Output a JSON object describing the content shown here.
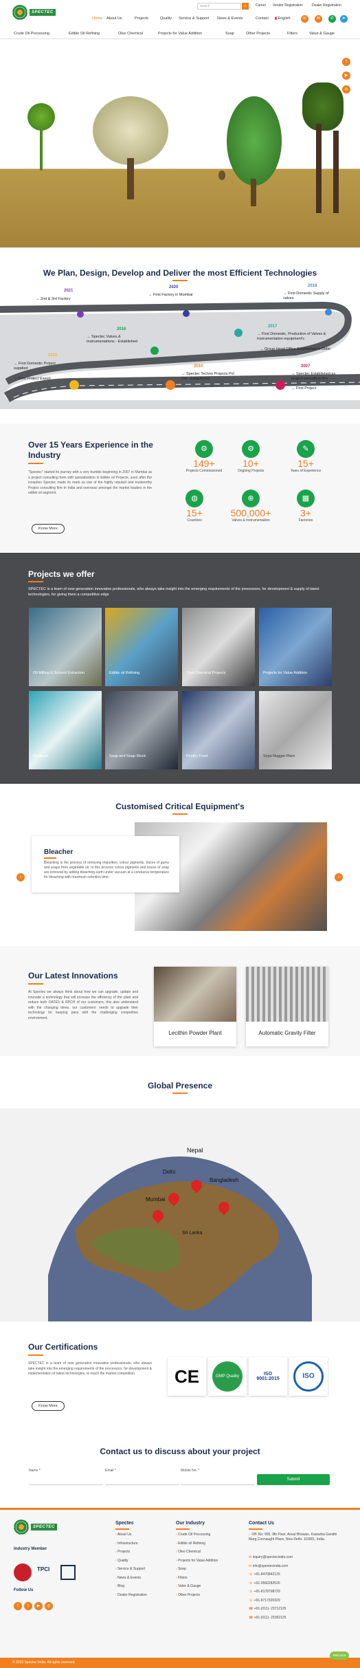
{
  "header": {
    "logo_text": "SPECTEC",
    "search_placeholder": "Search",
    "top_links": [
      "Career",
      "Vendor Registration",
      "Dealer Registration"
    ],
    "nav": [
      "Home",
      "About Us",
      "Projects",
      "Quality",
      "Service & Support",
      "News & Events",
      "Contact"
    ],
    "language": "English"
  },
  "menu": [
    "Crude Oil Processing",
    "Edible Oil Refining",
    "Oleo Chemical",
    "Projects for Value Addition",
    "Soap",
    "Other Projects",
    "Filters",
    "Value & Gauge"
  ],
  "timeline": {
    "title": "We Plan, Design, Develop and Deliver the most Efficient Technologies",
    "events": [
      {
        "year": "2021",
        "text": "→ 2nd & 3rd Factory"
      },
      {
        "year": "2020",
        "text": "→ First Factory in Mumbai"
      },
      {
        "year": "2018",
        "text": "→ First Domestic Supply of valves"
      },
      {
        "year": "2016",
        "text": "→ Spectec Valves & Instrumentations - Established"
      },
      {
        "year": "2017",
        "text": "→ First Domestic, Production of Valves & Instrumentation equipment's"
      },
      {
        "year": "",
        "text": "→ Group Head Office Established in Delhi"
      },
      {
        "year": "2011",
        "text": "→ First Domestic Project supplied"
      },
      {
        "year": "",
        "text": "→ First Project Export"
      },
      {
        "year": "2010",
        "text": "→ Spectec Techno Projects Pvt Ltd - Established"
      },
      {
        "year": "2007",
        "text": "→ Spectec Established as project consulting firm"
      },
      {
        "year": "",
        "text": "→ First Project"
      }
    ]
  },
  "experience": {
    "title": "Over 15 Years Experience in the Industry",
    "body": "\"Spectec\" started its journey with a very humble beginning in 2007 in Mumbai as a project consulting form with specialization in Edible oil Projects, soon after the inception Spectec made its mark as one of the highly reputed and trustworthy Project consulting firm in India and overseas amongst the market leaders in the edible oil segment.",
    "button": "Know More",
    "stats": [
      {
        "num": "149+",
        "label": "Projects Commissioned"
      },
      {
        "num": "10+",
        "label": "Ongoing Projects"
      },
      {
        "num": "15+",
        "label": "Years of Experience"
      },
      {
        "num": "15+",
        "label": "Countries"
      },
      {
        "num": "500,000+",
        "label": "Valves & Instrumentation"
      },
      {
        "num": "3+",
        "label": "Factories"
      }
    ]
  },
  "projects": {
    "title": "Projects we offer",
    "body": "SPECTEC is a team of new generation innovative professionals, who always take insight into the emerging requirements of the processors, for development & supply of latest technologies, for giving them a competitive edge",
    "items": [
      "Oil Milling & Solvent Extraction",
      "Edible oil Refining",
      "Oleo Chemical Projects",
      "Projects for Value Addition",
      "Biodiesel",
      "Soap and Soap Stock",
      "Poultry Food",
      "Soya Nugget Plant"
    ]
  },
  "equipment": {
    "title": "Customised Critical Equipment's",
    "card_title": "Bleacher",
    "card_body": "Bleaching is the process of removing impurities, colour pigments, traces of gums and soaps from vegetable oil. In this process colour pigments and traces of soap are removed by adding bleaching earth under vacuum at a conducive temperature for bleaching with maximum retention time."
  },
  "innovations": {
    "title": "Our Latest Innovations",
    "body": "At Spectec we always think about how we can upgrade, update and innovate a technology that will increase the efficiency of the plant and reduce both OATEX & RPCH of our customers, this also understand with the changing times, our customers' needs to upgrade their technology for keeping pace with the challenging competitive environment.",
    "cards": [
      "Lecithin Powder Plant",
      "Automatic Gravity Filter"
    ]
  },
  "global": {
    "title": "Global Presence",
    "places": [
      "Nepal",
      "Delhi",
      "Bangladesh",
      "Mumbai",
      "Sri Lanka"
    ]
  },
  "certifications": {
    "title": "Our Certifications",
    "body": "SPECTEC is a team of new generation innovative professionals, who always take insight into the emerging requirements of the processors, for development & implementation of latest technologies, to reach the market competition.",
    "button": "Know More",
    "badges": [
      "CE",
      "GMP Quality",
      "ISO 9001:2015",
      "ISO"
    ]
  },
  "contact": {
    "title": "Contact us to discuss about your project",
    "fields": [
      "Name *",
      "Email *",
      "Mobile No. *"
    ],
    "submit": "Submit"
  },
  "footer": {
    "industry_member": "Industry Member",
    "follow_us": "Follow Us",
    "col1_title": "Spectec",
    "col1": [
      "About Us",
      "Infrastructure",
      "Projects",
      "Quality",
      "Service & Support",
      "News & Events",
      "Blog",
      "Dealer Registration"
    ],
    "col2_title": "Our Industry",
    "col2": [
      "Crude Oil Processing",
      "Edible oil Refining",
      "Oleo Chemical",
      "Projects for Value Addition",
      "Soap",
      "Filters",
      "Valve & Gauge",
      "Other Projects"
    ],
    "contact_title": "Contact Us",
    "address": "Off. No. 905, 9th Floor, Ansal Bhawan, Kasturba Gandhi Marg,Connaught Place, New Delhi- 110001, India.",
    "contacts": [
      "inquiry@spectecindia.com",
      "info@spectecindia.com",
      "+91-8470842125",
      "+91-9560282526",
      "+91-8178798729",
      "+91-8717320329",
      "+91-(011)- 23712125",
      "+91-(011)- 23352125"
    ],
    "copyright": "© 2023 Spectec India. All rights reserved."
  },
  "chat": {
    "label": "Welcome"
  }
}
